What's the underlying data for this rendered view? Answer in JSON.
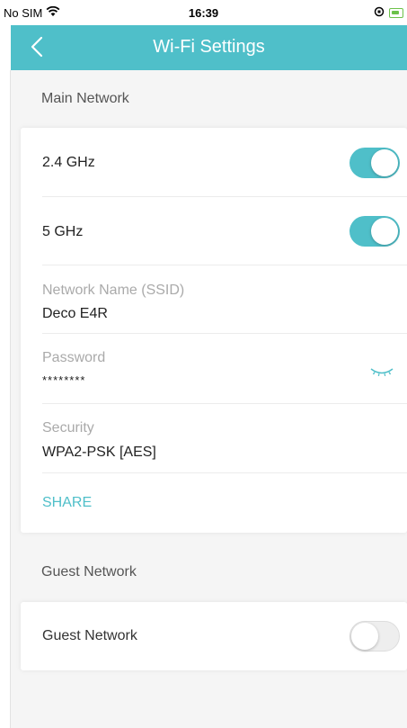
{
  "status_bar": {
    "carrier": "No SIM",
    "time": "16:39",
    "wifi_icon": "wifi-icon",
    "battery_icon": "battery-charging-icon"
  },
  "nav": {
    "title": "Wi-Fi Settings",
    "back_icon": "chevron-left-icon"
  },
  "main_network": {
    "header": "Main Network",
    "band_24": {
      "label": "2.4 GHz",
      "enabled": true
    },
    "band_5": {
      "label": "5 GHz",
      "enabled": true
    },
    "ssid": {
      "label": "Network Name (SSID)",
      "value": "Deco E4R"
    },
    "password": {
      "label": "Password",
      "value": "********",
      "icon": "eye-closed-icon"
    },
    "security": {
      "label": "Security",
      "value": "WPA2-PSK [AES]"
    },
    "share_label": "SHARE"
  },
  "guest_network": {
    "header": "Guest Network",
    "row_label": "Guest Network",
    "enabled": false
  },
  "colors": {
    "accent": "#4fbfc9",
    "background": "#f5f5f5",
    "card": "#ffffff"
  }
}
